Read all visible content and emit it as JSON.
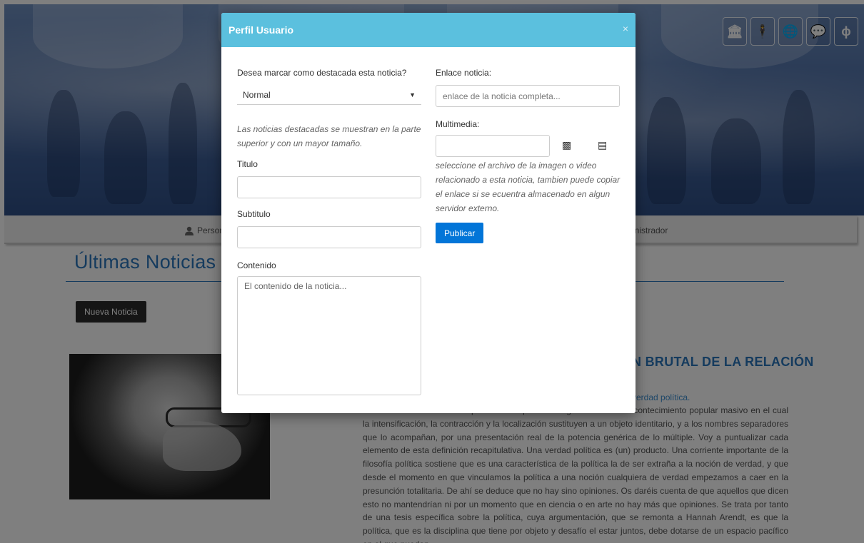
{
  "header_icons": [
    {
      "icon": "bank-icon",
      "glyph": "🏛"
    },
    {
      "icon": "person-icon",
      "glyph": "🕴"
    },
    {
      "icon": "globe-icon",
      "glyph": "🌐"
    },
    {
      "icon": "chat-bubble-icon",
      "glyph": "💬"
    },
    {
      "icon": "phi-icon",
      "glyph": "ɸ"
    }
  ],
  "navbar": {
    "left_label": "Person",
    "right_label": "inistrador"
  },
  "main": {
    "section_title": "Últimas Noticias",
    "new_button_label": "Nueva Noticia",
    "article": {
      "title": "N BRUTAL DE LA RELACIÓN",
      "subtitle": "a verdad política.",
      "body": "Os lo recuerdo: una verdad política es el producto organizado de un acontecimiento popular masivo en el cual la intensificación, la contracción y la localización sustituyen a un objeto identitario, y a los nombres separadores que lo acompañan, por una presentación real de la potencia genérica de lo múltiple. Voy a puntualizar cada elemento de esta definición recapitulativa. Una verdad política es (un) producto. Una corriente importante de la filosofía política sostiene que es una característica de la política la de ser extraña a la noción de verdad, y que desde el momento en que vinculamos la política a una noción cualquiera de verdad empezamos a caer en la presunción totalitaria. De ahí se deduce que no hay sino opiniones. Os daréis cuenta de que aquellos que dicen esto no mantendrían ni por un momento que en ciencia o en arte no hay más que opiniones. Se trata por tanto de una tesis específica sobre la política, cuya argumentación, que se remonta a Hannah Arendt, es que la política, que es la disciplina que tiene por objeto y desafío el estar juntos, debe dotarse de un espacio pacífico en el que puedan"
    }
  },
  "modal": {
    "title": "Perfil Usuario",
    "close_glyph": "×",
    "featured_label": "Desea marcar como destacada esta noticia?",
    "featured_value": "Normal",
    "featured_help": "Las noticias destacadas se muestran en la parte superior y con un mayor tamaño.",
    "title_label": "Titulo",
    "title_value": "",
    "subtitle_label": "Subtitulo",
    "subtitle_value": "",
    "content_label": "Contenido",
    "content_placeholder": "El contenido de la noticia...",
    "link_label": "Enlace noticia:",
    "link_placeholder": "enlace de la noticia completa...",
    "media_label": "Multimedia:",
    "media_value": "",
    "media_help": "seleccione el archivo de la imagen o video relacionado a esta noticia, tambien puede copiar el enlace si se ecuentra almacenado en algun servidor externo.",
    "image_icon_glyph": "▩",
    "video_icon_glyph": "▤",
    "publish_label": "Publicar"
  }
}
